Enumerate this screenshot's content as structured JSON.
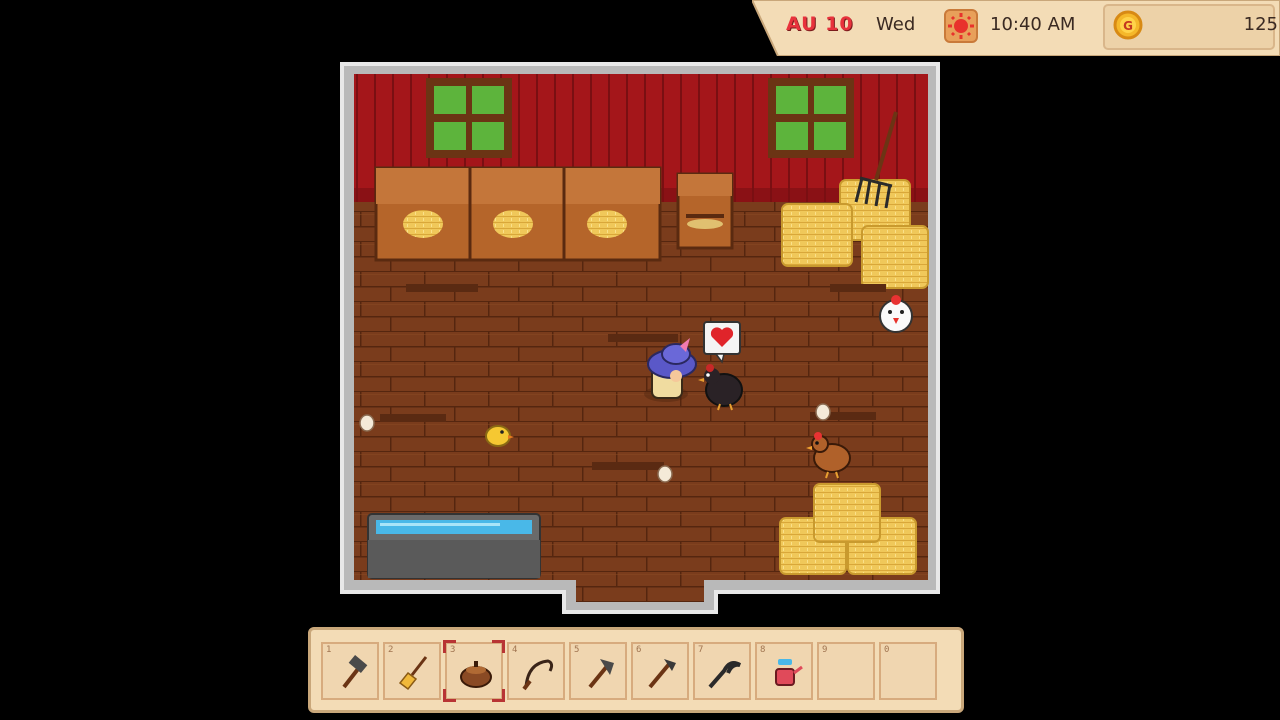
{
  "hud": {
    "date": "AU 10",
    "day": "Wed",
    "weather_icon": "sun-icon",
    "time": "10:40 AM",
    "gold_icon": "gold-coin-icon",
    "gold_coin_letter": "G",
    "gold": "125"
  },
  "hotbar": {
    "selected_index": 3,
    "slots": [
      {
        "num": "1",
        "icon": "hammer-icon"
      },
      {
        "num": "2",
        "icon": "broom-icon"
      },
      {
        "num": "3",
        "icon": "feed-bag-icon"
      },
      {
        "num": "4",
        "icon": "whip-icon"
      },
      {
        "num": "5",
        "icon": "axe-icon"
      },
      {
        "num": "6",
        "icon": "hoe-icon"
      },
      {
        "num": "7",
        "icon": "sickle-icon"
      },
      {
        "num": "8",
        "icon": "watering-can-icon"
      },
      {
        "num": "9",
        "icon": ""
      },
      {
        "num": "0",
        "icon": ""
      }
    ]
  },
  "scene": {
    "location": "chicken-coop",
    "animals": [
      "white-chicken",
      "black-chicken",
      "brown-chicken",
      "chick"
    ],
    "heart_bubble_icon": "heart-icon",
    "eggs_on_floor": 3,
    "colors": {
      "wall": "#a4161a",
      "floor": "#7a3c1c",
      "water": "#49b8e8"
    }
  }
}
